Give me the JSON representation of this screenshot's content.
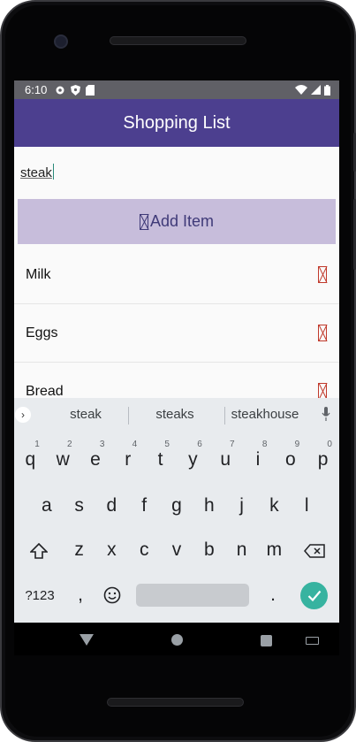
{
  "status_bar": {
    "time": "6:10",
    "icons_left": [
      "gear-icon",
      "shield-icon",
      "sd-card-icon"
    ],
    "icons_right": [
      "wifi-icon",
      "signal-icon",
      "battery-icon"
    ]
  },
  "app_bar": {
    "title": "Shopping List"
  },
  "input": {
    "value": "steak"
  },
  "add_button": {
    "label": "Add Item",
    "icon": "missing-glyph-icon"
  },
  "items": [
    {
      "label": "Milk"
    },
    {
      "label": "Eggs"
    },
    {
      "label": "Bread"
    }
  ],
  "keyboard": {
    "suggestions": [
      "steak",
      "steaks",
      "steakhouse"
    ],
    "row1": [
      {
        "key": "q",
        "hint": "1"
      },
      {
        "key": "w",
        "hint": "2"
      },
      {
        "key": "e",
        "hint": "3"
      },
      {
        "key": "r",
        "hint": "4"
      },
      {
        "key": "t",
        "hint": "5"
      },
      {
        "key": "y",
        "hint": "6"
      },
      {
        "key": "u",
        "hint": "7"
      },
      {
        "key": "i",
        "hint": "8"
      },
      {
        "key": "o",
        "hint": "9"
      },
      {
        "key": "p",
        "hint": "0"
      }
    ],
    "row2": [
      "a",
      "s",
      "d",
      "f",
      "g",
      "h",
      "j",
      "k",
      "l"
    ],
    "row3": [
      "z",
      "x",
      "c",
      "v",
      "b",
      "n",
      "m"
    ],
    "symbols_label": "?123",
    "comma": ",",
    "period": "."
  },
  "colors": {
    "app_bar": "#4c3f8f",
    "add_button_bg": "#c7bddb",
    "add_button_text": "#3f3a78",
    "delete_icon": "#c0392b",
    "enter_key": "#37b3a0"
  }
}
